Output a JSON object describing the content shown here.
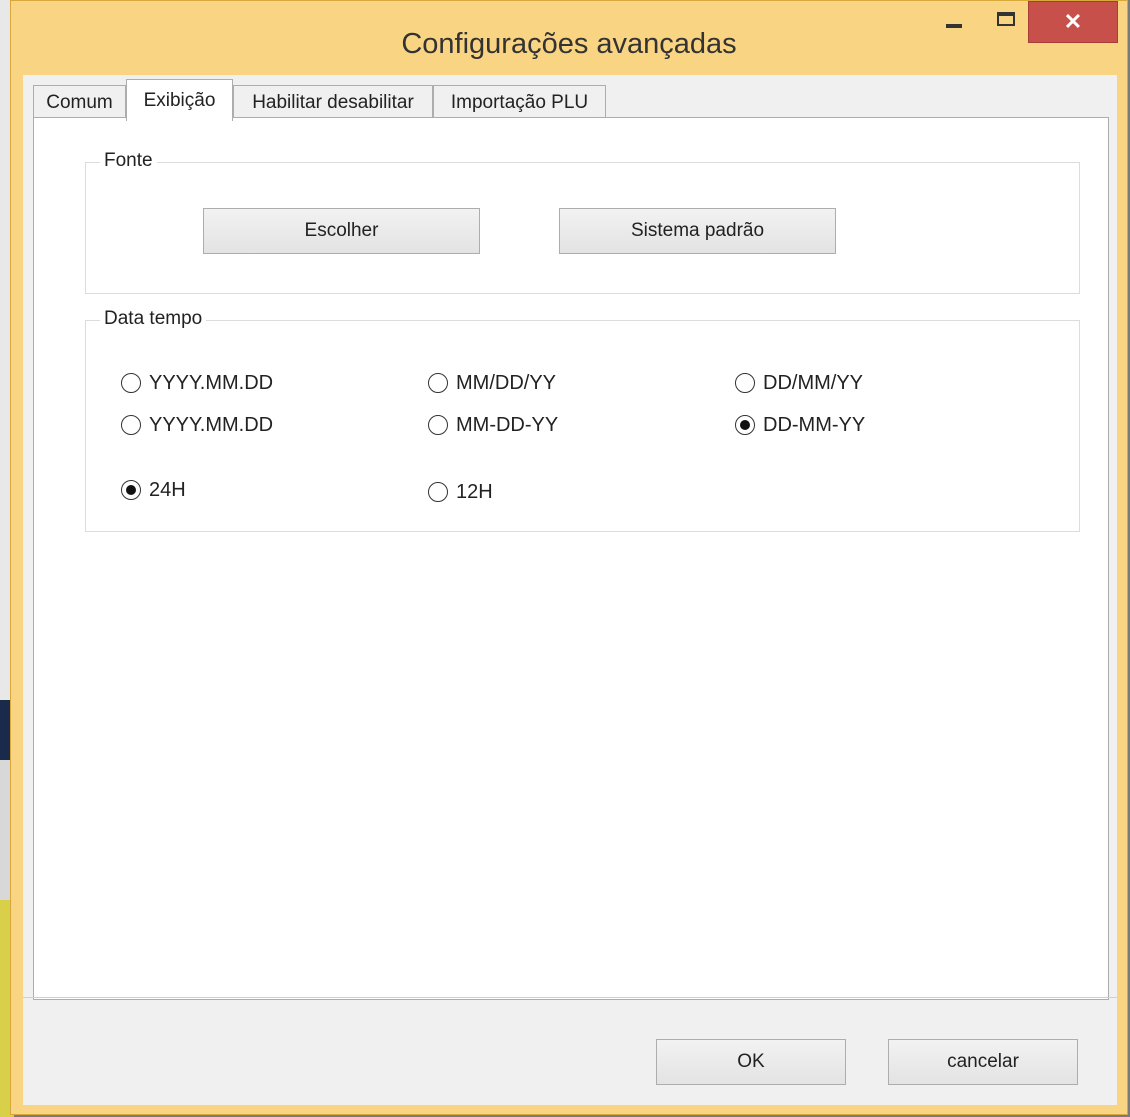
{
  "window": {
    "title": "Configurações avançadas",
    "close_glyph": "✕"
  },
  "tabs": [
    {
      "label": "Comum",
      "active": false
    },
    {
      "label": "Exibição",
      "active": true
    },
    {
      "label": "Habilitar desabilitar",
      "active": false
    },
    {
      "label": "Importação PLU",
      "active": false
    }
  ],
  "font_group": {
    "label": "Fonte",
    "choose_button": "Escolher",
    "system_default_button": "Sistema padrão"
  },
  "datetime_group": {
    "label": "Data tempo",
    "date_formats": [
      {
        "label": "YYYY.MM.DD",
        "selected": false
      },
      {
        "label": "MM/DD/YY",
        "selected": false
      },
      {
        "label": "DD/MM/YY",
        "selected": false
      },
      {
        "label": "YYYY.MM.DD",
        "selected": false
      },
      {
        "label": "MM-DD-YY",
        "selected": false
      },
      {
        "label": "DD-MM-YY",
        "selected": true
      }
    ],
    "time_formats": [
      {
        "label": "24H",
        "selected": true
      },
      {
        "label": "12H",
        "selected": false
      }
    ]
  },
  "footer": {
    "ok_button": "OK",
    "cancel_button": "cancelar"
  },
  "colors": {
    "title_bar": "#f9d483",
    "close_button": "#c7504a",
    "panel": "#ffffff"
  }
}
